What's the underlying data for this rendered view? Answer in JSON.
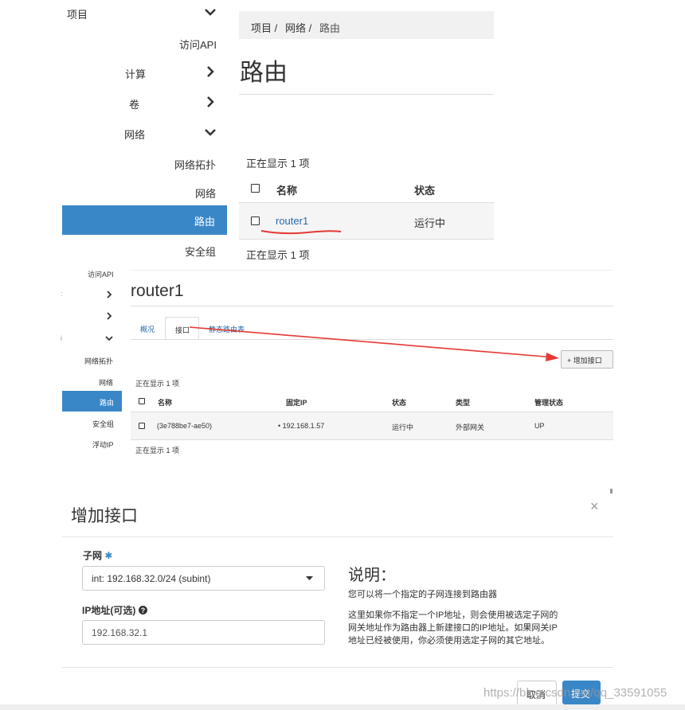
{
  "panel1": {
    "sidebar": [
      {
        "label": "项目",
        "chevron": "down"
      },
      {
        "label": "访问API",
        "chevron": ""
      },
      {
        "label": "计算",
        "chevron": "right"
      },
      {
        "label": "卷",
        "chevron": "right"
      },
      {
        "label": "网络",
        "chevron": "down"
      },
      {
        "label": "网络拓扑",
        "chevron": ""
      },
      {
        "label": "网络",
        "chevron": ""
      },
      {
        "label": "路由",
        "chevron": "",
        "active": true
      },
      {
        "label": "安全组",
        "chevron": ""
      }
    ],
    "breadcrumb": [
      "项目 /",
      "网络 /",
      "路由"
    ],
    "title": "路由",
    "count_top": "正在显示 1 项",
    "count_bottom": "正在显示 1 项",
    "columns": [
      "名称",
      "状态"
    ],
    "rows": [
      {
        "name": "router1",
        "status": "运行中"
      }
    ]
  },
  "panel2": {
    "sidebar": [
      "访问API",
      "网络拓扑",
      "网络",
      "路由",
      "安全组",
      "浮动IP"
    ],
    "title": "router1",
    "tabs": [
      "概况",
      "接口",
      "静态路由表"
    ],
    "add_button": "+ 增加接口",
    "count_top": "正在显示 1 项",
    "count_bottom": "正在显示 1 项",
    "columns": [
      "名称",
      "固定IP",
      "状态",
      "类型",
      "管理状态"
    ],
    "rows": [
      {
        "name": "(3e788be7-ae50)",
        "ip": "• 192.168.1.57",
        "status": "运行中",
        "type": "外部网关",
        "admin": "UP"
      }
    ]
  },
  "modal": {
    "title": "增加接口",
    "close": "×",
    "subnet_label": "子网",
    "required_mark": "✱",
    "subnet_value": "int: 192.168.32.0/24 (subint)",
    "ip_label": "IP地址(可选)",
    "ip_placeholder": "192.168.32.1",
    "desc_title": "说明：",
    "desc_line1": "您可以将一个指定的子网连接到路由器",
    "desc_para": [
      "这里如果你不指定一个IP地址，则会使用被选定子网的",
      "网关地址作为路由器上新建接口的IP地址。如果网关IP",
      "地址已经被使用，你必须使用选定子网的其它地址。"
    ],
    "cancel": "取消",
    "submit": "提交"
  },
  "watermark": "https://blog.csdn.net/qq_33591055",
  "colors": {
    "accent": "#3a87c8",
    "link": "#2a6aa8",
    "annotation": "#e53935"
  }
}
